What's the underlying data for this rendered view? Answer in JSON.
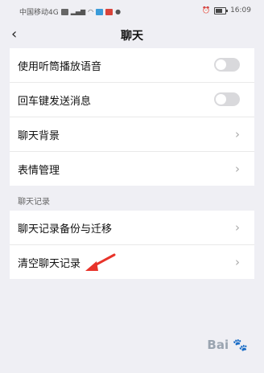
{
  "status_bar": {
    "carrier": "中国移动4G",
    "time": "16:09",
    "battery_level": 0.75
  },
  "header": {
    "back_icon": "chevron-left-icon",
    "title": "聊天"
  },
  "settings_group_1": [
    {
      "label": "使用听筒播放语音",
      "control": "toggle",
      "on": false
    },
    {
      "label": "回车键发送消息",
      "control": "toggle",
      "on": false
    },
    {
      "label": "聊天背景",
      "control": "chevron"
    },
    {
      "label": "表情管理",
      "control": "chevron"
    }
  ],
  "section_header": "聊天记录",
  "settings_group_2": [
    {
      "label": "聊天记录备份与迁移",
      "control": "chevron"
    },
    {
      "label": "清空聊天记录",
      "control": "chevron"
    }
  ],
  "chevron_glyph": "›",
  "accent_colors": {
    "toggle_off": "#d9d9dc",
    "arrow": "#e8332a"
  }
}
